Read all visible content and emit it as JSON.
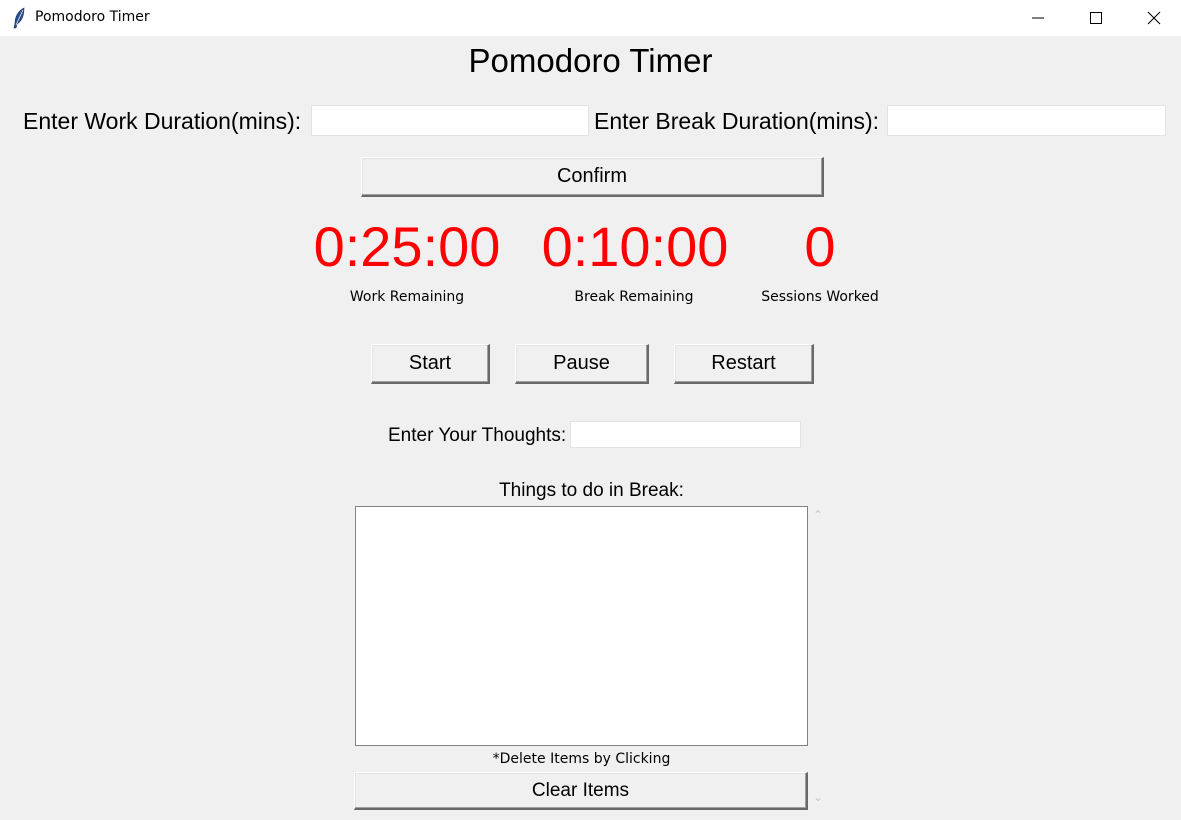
{
  "window": {
    "title": "Pomodoro Timer",
    "controls": {
      "minimize_icon": "minimize-icon",
      "maximize_icon": "maximize-icon",
      "close_icon": "close-icon"
    }
  },
  "main": {
    "heading": "Pomodoro Timer",
    "work_duration": {
      "label": "Enter Work Duration(mins):",
      "value": ""
    },
    "break_duration": {
      "label": "Enter Break Duration(mins):",
      "value": ""
    },
    "confirm_label": "Confirm",
    "timers": [
      {
        "value": "0:25:00",
        "caption": "Work Remaining"
      },
      {
        "value": "0:10:00",
        "caption": "Break Remaining"
      },
      {
        "value": "0",
        "caption": "Sessions Worked"
      }
    ],
    "controls": {
      "start": "Start",
      "pause": "Pause",
      "restart": "Restart"
    },
    "thoughts": {
      "label": "Enter Your Thoughts:",
      "value": ""
    },
    "break_list": {
      "label": "Things to do in Break:",
      "items": [],
      "hint": "*Delete Items by Clicking",
      "clear_label": "Clear Items"
    },
    "colors": {
      "timer": "#ff0000",
      "background": "#f0f0f0"
    }
  }
}
